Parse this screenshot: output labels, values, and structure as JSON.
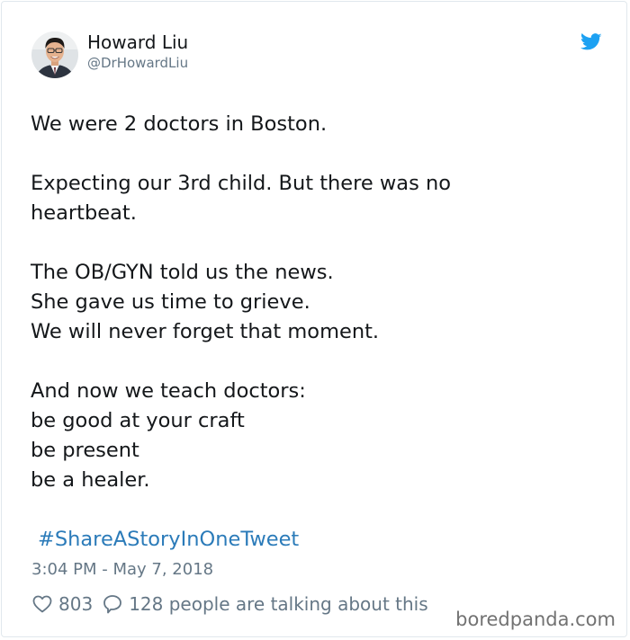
{
  "tweet": {
    "author_name": "Howard Liu",
    "author_handle": "@DrHowardLiu",
    "lines": [
      "We were 2 doctors in Boston.",
      "",
      "Expecting our 3rd child.  But there was no",
      "heartbeat.",
      "",
      "The OB/GYN told us the news.",
      "She gave us time to grieve.",
      "We will never forget that moment.",
      "",
      "And now we teach doctors:",
      "be good at your craft",
      "be present",
      "be a healer."
    ],
    "hashtag": "#ShareAStoryInOneTweet",
    "timestamp": "3:04 PM - May 7, 2018",
    "likes_count": "803",
    "replies_text": "128 people are talking about this"
  },
  "watermark": "boredpanda.com",
  "icons": {
    "platform": "twitter-bird-icon",
    "like": "heart-icon",
    "reply": "speech-bubble-icon"
  },
  "colors": {
    "text": "#14171a",
    "secondary": "#657786",
    "link": "#2b7bb9",
    "twitter_blue": "#1da1f2",
    "border": "#e1e8ed"
  }
}
